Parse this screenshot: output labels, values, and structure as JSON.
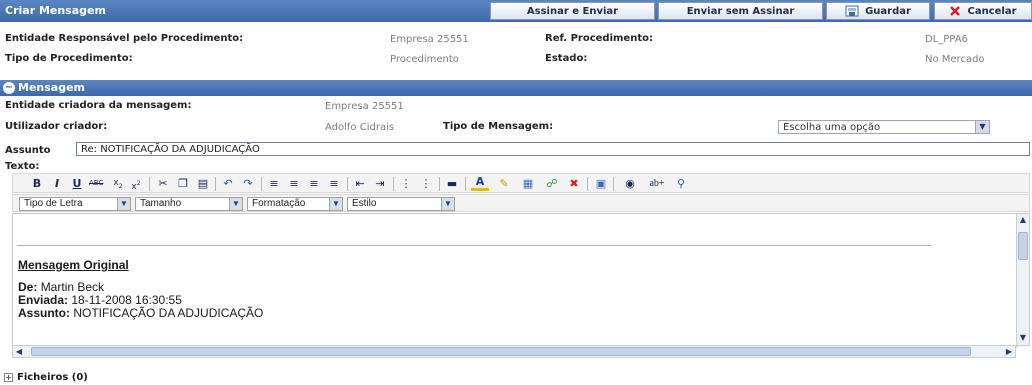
{
  "header": {
    "title": "Criar Mensagem",
    "buttons": {
      "sign_send": "Assinar e Enviar",
      "send_unsigned": "Enviar sem Assinar",
      "save": "Guardar",
      "cancel": "Cancelar"
    }
  },
  "procedure": {
    "entity_label": "Entidade Responsável pelo Procedimento:",
    "entity_value": "Empresa 25551",
    "ref_label": "Ref. Procedimento:",
    "ref_value": "DL_PPA6",
    "type_label": "Tipo de Procedimento:",
    "type_value": "Procedimento",
    "state_label": "Estado:",
    "state_value": "No Mercado"
  },
  "message": {
    "section_title": "Mensagem",
    "creator_entity_label": "Entidade criadora da mensagem:",
    "creator_entity_value": "Empresa 25551",
    "creator_user_label": "Utilizador criador:",
    "creator_user_value": "Adolfo Cidrais",
    "message_type_label": "Tipo de Mensagem:",
    "message_type_value": "Escolha uma opção",
    "subject_label": "Assunto",
    "subject_value": "Re: NOTIFICAÇÃO DA ADJUDICAÇÃO",
    "text_label": "Texto:"
  },
  "format_bar": {
    "font": "Tipo de Letra",
    "size": "Tamanho",
    "format": "Formatação",
    "style": "Estilo"
  },
  "editor": {
    "original_heading": "Mensagem Original",
    "from_label": "De:",
    "from_value": "Martin Beck",
    "sent_label": "Enviada:",
    "sent_value": "18-11-2008 16:30:55",
    "subject_label": "Assunto:",
    "subject_value": "NOTIFICAÇÃO DA ADJUDICAÇÃO"
  },
  "files": {
    "label": "Ficheiros (0)"
  },
  "toolbar_icons": [
    "bold-icon",
    "italic-icon",
    "underline-icon",
    "strikethrough-icon",
    "subscript-icon",
    "superscript-icon",
    "cut-icon",
    "copy-icon",
    "paste-icon",
    "undo-icon",
    "redo-icon",
    "align-left-icon",
    "align-center-icon",
    "align-right-icon",
    "justify-icon",
    "outdent-icon",
    "indent-icon",
    "bulleted-list-icon",
    "numbered-list-icon",
    "horizontal-rule-icon",
    "font-color-icon",
    "highlight-icon",
    "table-icon",
    "link-icon",
    "unlink-icon",
    "preview-icon",
    "find-icon",
    "replace-icon",
    "zoom-icon"
  ],
  "colors": {
    "header_blue": "#3d68ab",
    "label_text": "#222222",
    "value_text": "#7d7d7d"
  }
}
